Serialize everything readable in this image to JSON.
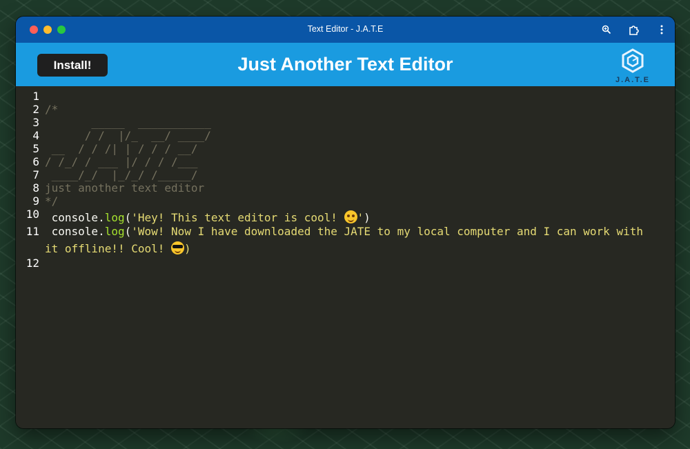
{
  "window": {
    "title": "Text Editor - J.A.T.E"
  },
  "toolbar_icons": [
    "zoom-icon",
    "extension-icon",
    "more-vert-icon"
  ],
  "header": {
    "install_label": "Install!",
    "title": "Just Another Text Editor",
    "logo_text": "J.A.T.E"
  },
  "editor": {
    "line_numbers": [
      "1",
      "2",
      "3",
      "4",
      "5",
      "6",
      "7",
      "8",
      "9",
      "10",
      "11",
      "12"
    ],
    "ascii": {
      "l2": "/*",
      "l3": "       _____  ___________",
      "l4": "      / /  |/_  __/ ____/",
      "l5": " __  / / /| | / / / __/",
      "l6": "/ /_/ / ___ |/ / / /___",
      "l7": " ____/_/  |_/_/ /_____/",
      "l8": "just another text editor",
      "l9": "*/"
    },
    "line10": {
      "obj": " console.",
      "fn": "log",
      "open": "(",
      "str": "'Hey! This text editor is cool! ",
      "str_end": "'",
      "close": ")"
    },
    "line11": {
      "obj": " console.",
      "fn": "log",
      "open": "(",
      "str": "'Wow! Now I have downloaded the JATE to my local computer and I can work with",
      "wrap": "it offline!! Cool! ",
      "close": ")"
    }
  },
  "colors": {
    "title_bar": "#0a56a7",
    "header": "#1a9be0",
    "editor_bg": "#272822",
    "comment": "#75715e",
    "function": "#a6e22e",
    "string": "#e6db74"
  }
}
